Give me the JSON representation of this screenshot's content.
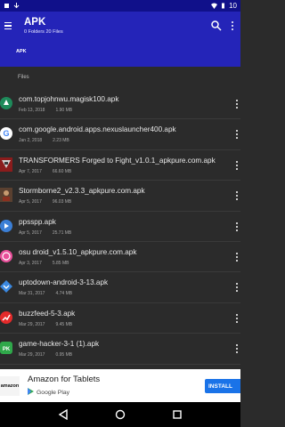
{
  "status_bar": {
    "time": "10"
  },
  "header": {
    "title": "APK",
    "subtitle": "0 Folders 20 Files",
    "breadcrumb": "APK"
  },
  "section_label": "Files",
  "files": [
    {
      "name": "com.topjohnwu.magisk100.apk",
      "date": "Feb 13, 2018",
      "size": "1.90 MB",
      "icon": "magisk-app-icon",
      "color": "#1e8a5a"
    },
    {
      "name": "com.google.android.apps.nexuslauncher400.apk",
      "date": "Jan 2, 2018",
      "size": "2.23 MB",
      "icon": "google-app-icon",
      "color": "#ffffff"
    },
    {
      "name": "TRANSFORMERS Forged to Fight_v1.0.1_apkpure.com.apk",
      "date": "Apr 7, 2017",
      "size": "66.60 MB",
      "icon": "transformers-app-icon",
      "color": "#8b1c1c"
    },
    {
      "name": "Stormborne2_v2.3.3_apkpure.com.apk",
      "date": "Apr 5, 2017",
      "size": "96.03 MB",
      "icon": "stormborne-app-icon",
      "color": "#5a4030"
    },
    {
      "name": "ppsspp.apk",
      "date": "Apr 5, 2017",
      "size": "25.71 MB",
      "icon": "ppsspp-app-icon",
      "color": "#3b7fd6"
    },
    {
      "name": "osu droid_v1.5.10_apkpure.com.apk",
      "date": "Apr 3, 2017",
      "size": "5.85 MB",
      "icon": "osu-app-icon",
      "color": "#e8509a"
    },
    {
      "name": "uptodown-android-3-13.apk",
      "date": "Mar 31, 2017",
      "size": "4.74 MB",
      "icon": "uptodown-app-icon",
      "color": "#3a88e0"
    },
    {
      "name": "buzzfeed-5-3.apk",
      "date": "Mar 29, 2017",
      "size": "9.45 MB",
      "icon": "buzzfeed-app-icon",
      "color": "#e32a2a"
    },
    {
      "name": "game-hacker-3-1 (1).apk",
      "date": "Mar 29, 2017",
      "size": "0.95 MB",
      "icon": "game-hacker-app-icon",
      "color": "#2fa84a"
    }
  ],
  "ad": {
    "logo_text": "amazon",
    "title": "Amazon for Tablets",
    "store": "Google Play",
    "install_label": "INSTALL"
  },
  "colors": {
    "header": "#2424b8",
    "status_bar": "#10108a",
    "background": "#2b2b2b",
    "install": "#1a73e8"
  }
}
